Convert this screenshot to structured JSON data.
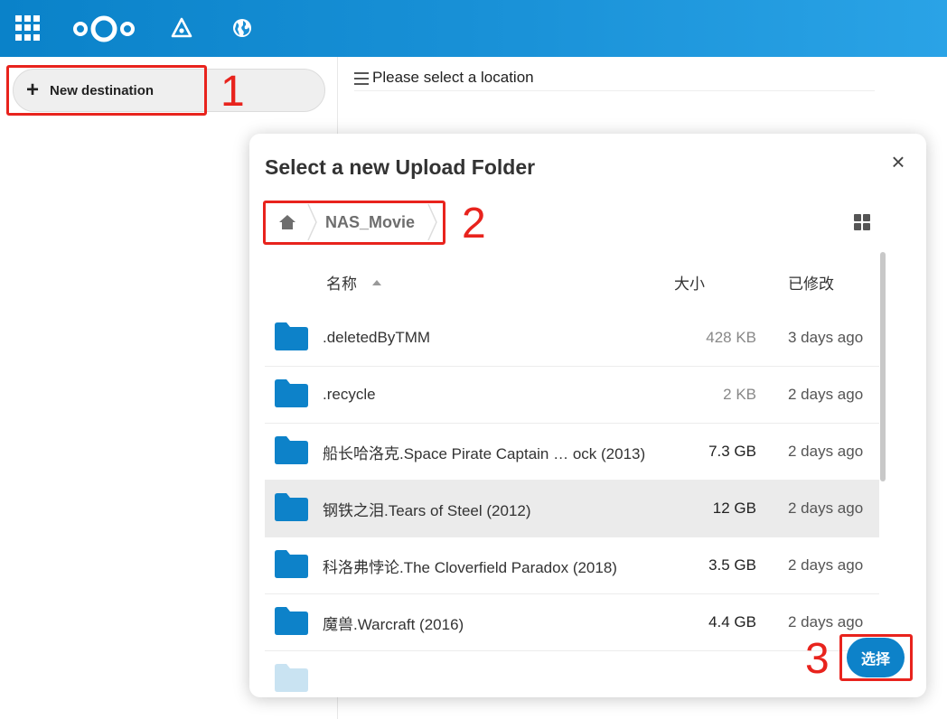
{
  "header": {
    "apps_icon": "apps-grid-icon",
    "logo_icon": "nextcloud-logo-icon",
    "nav_icons": [
      "activity-icon",
      "globe-icon"
    ]
  },
  "sidebar": {
    "new_destination_label": "New destination",
    "new_destination_icon": "plus-icon"
  },
  "main": {
    "location_prompt": "Please select a location"
  },
  "dialog": {
    "title": "Select a new Upload Folder",
    "close_label": "×",
    "breadcrumb": {
      "home_icon": "home-icon",
      "folder": "NAS_Movie"
    },
    "view_toggle_icon": "grid-view-icon",
    "columns": {
      "name": "名称",
      "size": "大小",
      "modified": "已修改"
    },
    "files": [
      {
        "name": ".deletedByTMM",
        "size": "428 KB",
        "modified": "3 days ago"
      },
      {
        "name": ".recycle",
        "size": "2 KB",
        "modified": "2 days ago"
      },
      {
        "name": "船长哈洛克.Space Pirate Captain … ock (2013)",
        "size": "7.3 GB",
        "modified": "2 days ago"
      },
      {
        "name": "钢铁之泪.Tears of Steel (2012)",
        "size": "12 GB",
        "modified": "2 days ago"
      },
      {
        "name": "科洛弗悖论.The Cloverfield Paradox (2018)",
        "size": "3.5 GB",
        "modified": "2 days ago"
      },
      {
        "name": "魔兽.Warcraft (2016)",
        "size": "4.4 GB",
        "modified": "2 days ago"
      },
      {
        "name": "",
        "size": "",
        "modified": ""
      }
    ],
    "choose_label": "选择"
  },
  "annotations": [
    "1",
    "2",
    "3"
  ],
  "colors": {
    "header_blue": "#0a82c9",
    "folder_blue": "#0d82c9",
    "annotation_red": "#e8231d"
  }
}
